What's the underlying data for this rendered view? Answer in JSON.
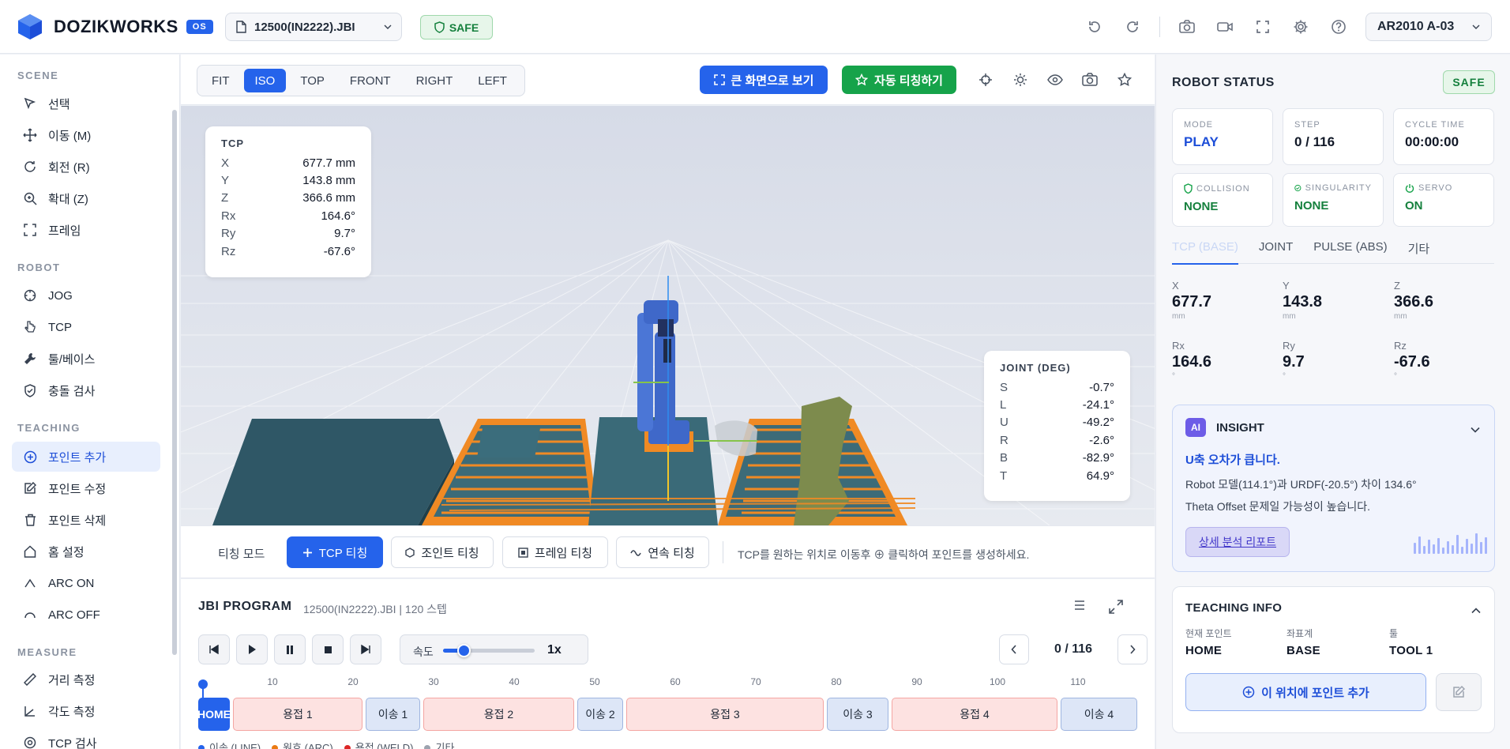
{
  "app": {
    "brand": "DOZIKWORKS",
    "os_badge": "OS",
    "file": "12500(IN2222).JBI",
    "safe": "SAFE",
    "robot": "AR2010 A-03"
  },
  "colors": {
    "accent": "#2563eb",
    "safe_green": "#16a34a",
    "weld": "#fde2e1",
    "move": "#dde6f7"
  },
  "top_icons": [
    "undo-icon",
    "redo-icon",
    "camera-icon",
    "video-icon",
    "fullscreen-icon",
    "gear-icon",
    "help-icon"
  ],
  "sidebar": {
    "scene_label": "SCENE",
    "scene": [
      "선택",
      "이동 (M)",
      "회전 (R)",
      "확대 (Z)",
      "프레임"
    ],
    "robot_label": "ROBOT",
    "robot": [
      "JOG",
      "TCP",
      "툴/베이스",
      "충돌 검사"
    ],
    "teaching_label": "TEACHING",
    "teaching": [
      "포인트 추가",
      "포인트 수정",
      "포인트 삭제",
      "홈 설정",
      "ARC ON",
      "ARC OFF"
    ],
    "measure_label": "MEASURE",
    "measure": [
      "거리 측정",
      "각도 측정",
      "TCP 검사"
    ]
  },
  "view": {
    "tabs": [
      "FIT",
      "ISO",
      "TOP",
      "FRONT",
      "RIGHT",
      "LEFT"
    ],
    "active": "ISO",
    "big_view": "큰 화면으로 보기",
    "auto_teach": "자동 티칭하기"
  },
  "tcp_overlay": {
    "title": "TCP",
    "rows": [
      {
        "k": "X",
        "v": "677.7 mm"
      },
      {
        "k": "Y",
        "v": "143.8 mm"
      },
      {
        "k": "Z",
        "v": "366.6 mm"
      },
      {
        "k": "Rx",
        "v": "164.6°"
      },
      {
        "k": "Ry",
        "v": "9.7°"
      },
      {
        "k": "Rz",
        "v": "-67.6°"
      }
    ]
  },
  "joint_overlay": {
    "title": "JOINT (DEG)",
    "rows": [
      {
        "k": "S",
        "v": "-0.7°"
      },
      {
        "k": "L",
        "v": "-24.1°"
      },
      {
        "k": "U",
        "v": "-49.2°"
      },
      {
        "k": "R",
        "v": "-2.6°"
      },
      {
        "k": "B",
        "v": "-82.9°"
      },
      {
        "k": "T",
        "v": "64.9°"
      }
    ]
  },
  "teach": {
    "mode_label": "티칭 모드",
    "buttons": [
      "TCP 티칭",
      "조인트 티칭",
      "프레임 티칭",
      "연속 티칭"
    ],
    "hint": "TCP를 원하는 위치로 이동후 ⊕ 클릭하여 포인트를 생성하세요."
  },
  "program": {
    "title": "JBI PROGRAM",
    "subtitle": "12500(IN2222).JBI | 120 스텝",
    "speed_label": "속도",
    "speed_value": "1x",
    "speed_fraction": 0.22,
    "step_counter": "0 / 116",
    "ticks": [
      "10",
      "20",
      "30",
      "40",
      "50",
      "60",
      "70",
      "80",
      "90",
      "100",
      "110"
    ],
    "segments": [
      {
        "label": "HOME",
        "kind": "home"
      },
      {
        "label": "용접 1",
        "kind": "weld"
      },
      {
        "label": "이송 1",
        "kind": "move"
      },
      {
        "label": "용접 2",
        "kind": "weld"
      },
      {
        "label": "이송 2",
        "kind": "move"
      },
      {
        "label": "용접 3",
        "kind": "weld"
      },
      {
        "label": "이송 3",
        "kind": "move"
      },
      {
        "label": "용접 4",
        "kind": "weld"
      },
      {
        "label": "이송 4",
        "kind": "move"
      }
    ],
    "legend": [
      {
        "label": "이송 (LINE)",
        "color": "#2563eb"
      },
      {
        "label": "원호 (ARC)",
        "color": "#ea7a12"
      },
      {
        "label": "용접 (WELD)",
        "color": "#dc2626"
      },
      {
        "label": "기타",
        "color": "#9ca3af"
      }
    ]
  },
  "robot_status": {
    "title": "ROBOT STATUS",
    "safe": "SAFE",
    "mode_label": "MODE",
    "mode": "PLAY",
    "step_label": "STEP",
    "step": "0 / 116",
    "cycle_label": "CYCLE TIME",
    "cycle": "00:00:00",
    "collision_label": "COLLISION",
    "collision": "NONE",
    "singularity_label": "SINGULARITY",
    "singularity": "NONE",
    "servo_label": "SERVO",
    "servo": "ON",
    "tabs": [
      "TCP (BASE)",
      "JOINT",
      "PULSE (ABS)",
      "기타"
    ],
    "pos": [
      {
        "k": "X",
        "v": "677.7",
        "u": "mm"
      },
      {
        "k": "Y",
        "v": "143.8",
        "u": "mm"
      },
      {
        "k": "Z",
        "v": "366.6",
        "u": "mm"
      },
      {
        "k": "Rx",
        "v": "164.6",
        "u": "°"
      },
      {
        "k": "Ry",
        "v": "9.7",
        "u": "°"
      },
      {
        "k": "Rz",
        "v": "-67.6",
        "u": "°"
      }
    ]
  },
  "insight": {
    "badge": "AI",
    "title": "INSIGHT",
    "headline": "U축 오차가 큽니다.",
    "line1": "Robot 모델(114.1°)과 URDF(-20.5°) 차이 134.6°",
    "line2": "Theta Offset 문제일 가능성이 높습니다.",
    "button": "상세 분석 리포트"
  },
  "teaching_info": {
    "title": "TEACHING INFO",
    "current_point_label": "현재 포인트",
    "current_point": "HOME",
    "coord_label": "좌표계",
    "coord": "BASE",
    "tool_label": "툴",
    "tool": "TOOL 1",
    "add_button": "이 위치에 포인트 추가"
  }
}
